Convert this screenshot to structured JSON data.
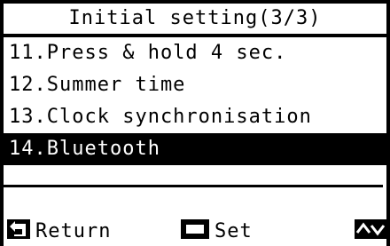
{
  "screen": {
    "title": "Initial setting(3/3)"
  },
  "menu": {
    "items": [
      {
        "label": "11.Press & hold 4 sec.",
        "selected": false
      },
      {
        "label": "12.Summer time",
        "selected": false
      },
      {
        "label": "13.Clock synchronisation",
        "selected": false
      },
      {
        "label": "14.Bluetooth",
        "selected": true
      }
    ]
  },
  "footer": {
    "return_label": "Return",
    "return_icon": "return-arrow-icon",
    "set_label": "Set",
    "set_icon": "square-button-icon",
    "nav_icon": "up-down-arrows-icon"
  },
  "colors": {
    "foreground": "#000000",
    "background": "#ffffff",
    "selected_bg": "#000000",
    "selected_fg": "#ffffff"
  }
}
